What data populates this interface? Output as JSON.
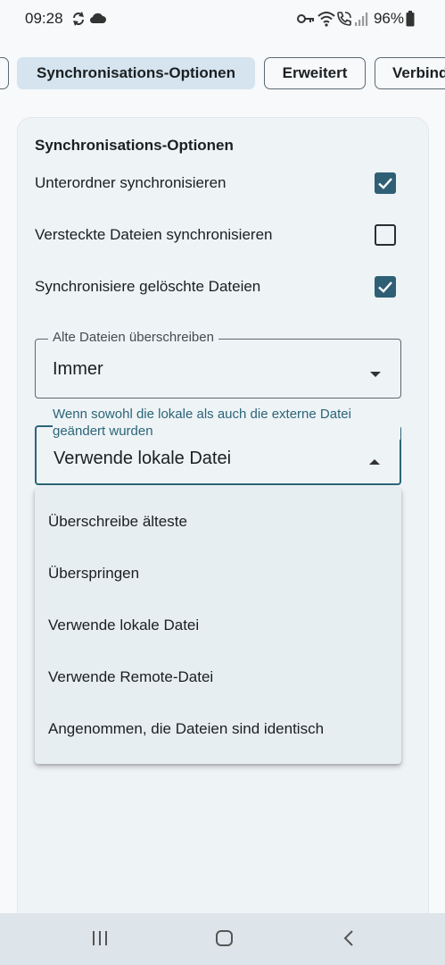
{
  "status_bar": {
    "time": "09:28",
    "battery": "96%",
    "icons": [
      "sync-icon",
      "cloud-icon",
      "key-icon",
      "wifi-icon",
      "call-icon",
      "signal-icon",
      "battery-icon"
    ]
  },
  "tabs": [
    {
      "label": ""
    },
    {
      "label": "Synchronisations-Optionen",
      "selected": true
    },
    {
      "label": "Erweitert"
    },
    {
      "label": "Verbindung"
    }
  ],
  "section": {
    "title": "Synchronisations-Optionen",
    "options": [
      {
        "label": "Unterordner synchronisieren",
        "checked": true
      },
      {
        "label": "Versteckte Dateien synchronisieren",
        "checked": false
      },
      {
        "label": "Synchronisiere gelöschte Dateien",
        "checked": true
      }
    ]
  },
  "overwrite_select": {
    "label": "Alte Dateien überschreiben",
    "value": "Immer"
  },
  "conflict_select": {
    "label": "Wenn sowohl die lokale als auch die externe Datei geändert wurden",
    "value": "Verwende lokale Datei",
    "expanded": true,
    "options": [
      "Überschreibe älteste",
      "Überspringen",
      "Verwende lokale Datei",
      "Verwende Remote-Datei",
      "Angenommen, die Dateien sind identisch"
    ]
  },
  "colors": {
    "accent": "#2b6578",
    "checkbox": "#2f5f75",
    "selected_tab": "#d5e4ee",
    "card": "#eef3f6",
    "menu": "#e6eef1",
    "nav_bar": "#dde5ea"
  },
  "nav_bar": {
    "buttons": [
      "recents-icon",
      "home-icon",
      "back-icon"
    ]
  }
}
